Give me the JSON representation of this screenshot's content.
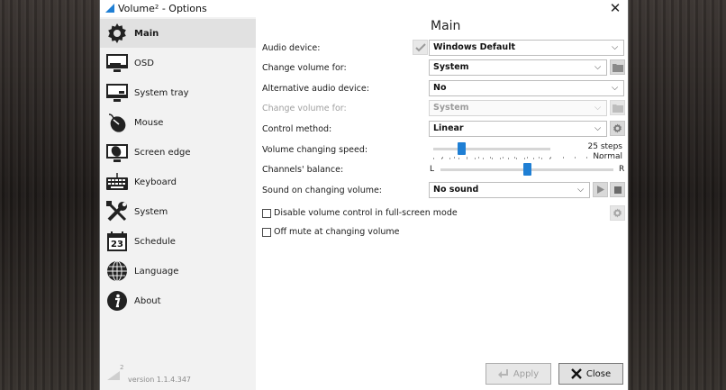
{
  "window": {
    "title": "Volume² - Options"
  },
  "sidebar": {
    "items": [
      {
        "label": "Main",
        "icon": "gear-icon",
        "active": true
      },
      {
        "label": "OSD",
        "icon": "monitor-icon"
      },
      {
        "label": "System tray",
        "icon": "system-tray-icon"
      },
      {
        "label": "Mouse",
        "icon": "mouse-icon"
      },
      {
        "label": "Screen edge",
        "icon": "screen-edge-icon"
      },
      {
        "label": "Keyboard",
        "icon": "keyboard-icon"
      },
      {
        "label": "System",
        "icon": "tools-icon"
      },
      {
        "label": "Schedule",
        "icon": "calendar-icon",
        "icon_text": "23"
      },
      {
        "label": "Language",
        "icon": "globe-icon"
      },
      {
        "label": "About",
        "icon": "info-icon"
      }
    ]
  },
  "version": {
    "text": "version 1.1.4.347",
    "badge": "2"
  },
  "main": {
    "title": "Main",
    "audio_device": {
      "label": "Audio device:",
      "value": "Windows Default"
    },
    "change_volume_for": {
      "label": "Change volume for:",
      "value": "System"
    },
    "alt_audio_device": {
      "label": "Alternative audio device:",
      "value": "No"
    },
    "change_volume_for_alt": {
      "label": "Change volume for:",
      "value": "System"
    },
    "control_method": {
      "label": "Control method:",
      "value": "Linear"
    },
    "volume_speed": {
      "label": "Volume changing speed:",
      "value_text": "25 steps",
      "mode_text": "Normal",
      "position": 0.24
    },
    "balance": {
      "label": "Channels' balance:",
      "left": "L",
      "right": "R",
      "position": 0.5
    },
    "sound": {
      "label": "Sound on changing volume:",
      "value": "No sound"
    },
    "checkboxes": [
      {
        "label": "Disable volume control in full-screen mode",
        "checked": false
      },
      {
        "label": "Off mute at changing volume",
        "checked": false
      }
    ]
  },
  "footer": {
    "apply_label": "Apply",
    "close_label": "Close"
  },
  "colors": {
    "accent": "#1f7fd4",
    "active_nav": "#e1e1e1",
    "sidebar_bg": "#f2f2f2"
  }
}
